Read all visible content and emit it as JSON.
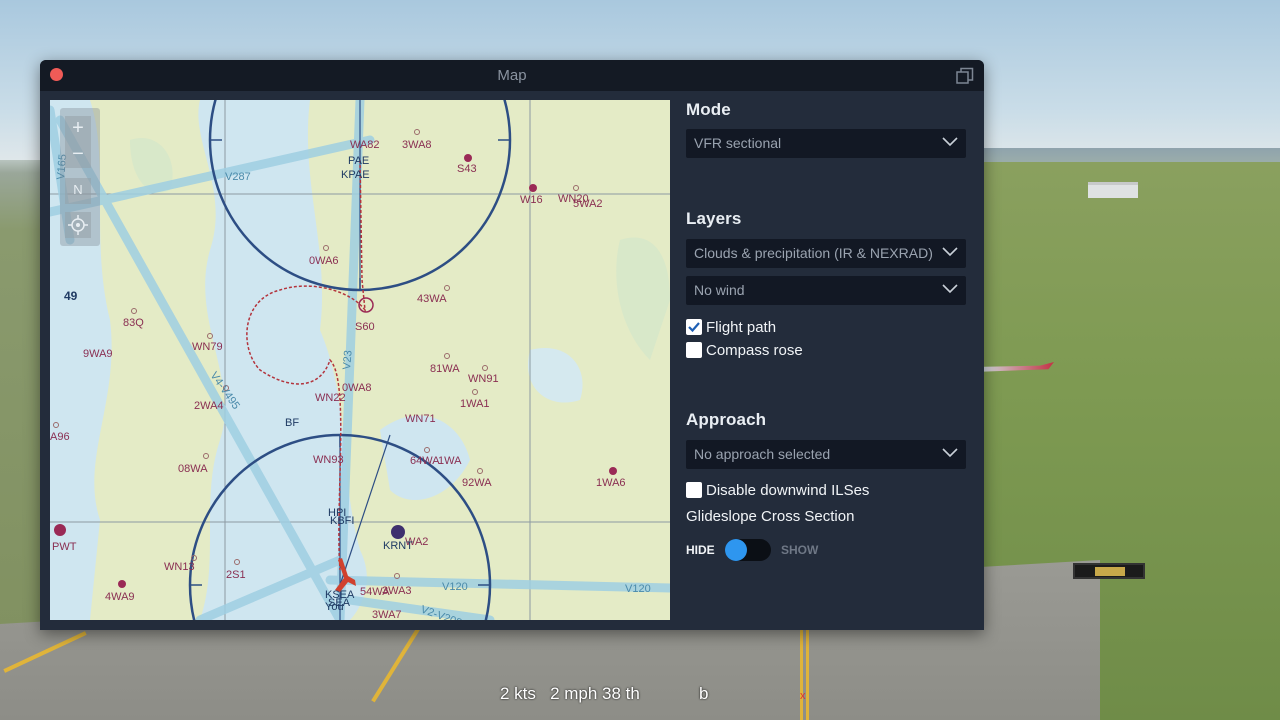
{
  "window": {
    "title": "Map"
  },
  "map": {
    "labels": {
      "v165": "V165",
      "v287": "V287",
      "kpae": "KPAE",
      "pae": "PAE",
      "wa82": "WA82",
      "wa3w8": "3WA8",
      "s43": "S43",
      "w16": "W16",
      "wn20": "WN20",
      "wa5wa2": "5WA2",
      "owa6": "0WA6",
      "n49": "49",
      "q83": "83Q",
      "wa9": "9WA9",
      "wn79": "WN79",
      "s60": "S60",
      "wa43": "43WA",
      "wa81": "81WA",
      "wn91": "WN91",
      "wa1": "1WA1",
      "wa0": "0WA8",
      "wn22": "WN22",
      "wa2": "2WA4",
      "a96": "A96",
      "wn71": "WN71",
      "wn93": "WN93",
      "wa08": "08WA",
      "wa64": "64WA",
      "wa61": "1WA",
      "wa92": "92WA",
      "wa1wa6": "1WA6",
      "pwt": "PWT",
      "wn13": "WN13",
      "s2s1": "2S1",
      "wa4wa9": "4WA9",
      "bfi": "KBFI",
      "hpi": "HPI",
      "rnt": "KRNT",
      "wa3wa2": "WA2",
      "sea": "KSEA",
      "seatxt": "SEA",
      "you": "You",
      "wa54": "54WA",
      "wa3wa3": "3WA3",
      "wa3wa7": "3WA7",
      "v120a": "V120",
      "v120b": "V120",
      "v23": "V23",
      "v4v495": "V4-V495",
      "v2v208": "V2-V208",
      "bf": "BF",
      "wo": "W0"
    },
    "controls": {
      "zoom_in": "+",
      "zoom_out": "−",
      "north": "N"
    }
  },
  "panel": {
    "mode": {
      "title": "Mode",
      "value": "VFR sectional"
    },
    "layers": {
      "title": "Layers",
      "weather": "Clouds & precipitation (IR & NEXRAD)",
      "wind": "No wind",
      "flight_path_label": "Flight path",
      "flight_path_checked": true,
      "compass_rose_label": "Compass rose",
      "compass_rose_checked": false
    },
    "approach": {
      "title": "Approach",
      "value": "No approach selected",
      "disable_downwind_label": "Disable downwind ILSes",
      "disable_downwind_checked": false,
      "glideslope_label": "Glideslope Cross Section",
      "hide_label": "HIDE",
      "show_label": "SHOW",
      "glideslope_on": false
    }
  },
  "hud": {
    "text": "2 kts   2 mph 38 th",
    "b": "b",
    "x": "x"
  },
  "colors": {
    "accent": "#2e96ef",
    "window_bg": "#232c3b",
    "close": "#f05b57"
  }
}
